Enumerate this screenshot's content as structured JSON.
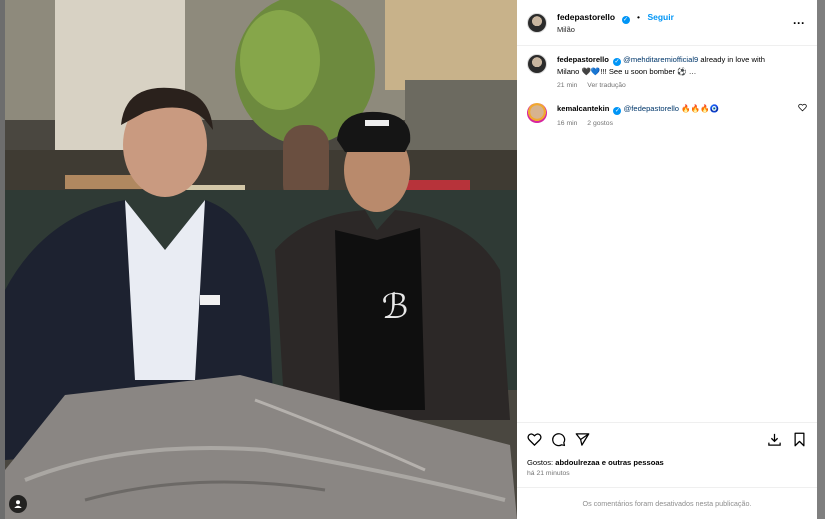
{
  "post": {
    "author": "fedepastorello",
    "follow_label": "Seguir",
    "location": "Milão",
    "more_icon": "more-horizontal-icon"
  },
  "caption": {
    "user": "fedepastorello",
    "mention": "@mehditaremiofficial9",
    "text": "already in love with Milano 🖤💙!!! See u soon bomber ⚽ …",
    "time": "21 min",
    "translate_label": "Ver tradução"
  },
  "comments": [
    {
      "user": "kemalcantekin",
      "mention": "@fedepastorello",
      "text": "🔥🔥🔥🧿",
      "time": "16 min",
      "likes": "2 gostos"
    }
  ],
  "actions": {
    "likes_prefix": "Gostos:",
    "likes_user": "abdoulrezaa",
    "likes_suffix": "e outras pessoas",
    "time": "há 21 minutos"
  },
  "footer": {
    "comments_disabled": "Os comentários foram desativados nesta publicação."
  },
  "colors": {
    "accent": "#0095f6",
    "mention": "#00376b",
    "muted": "#737373"
  }
}
